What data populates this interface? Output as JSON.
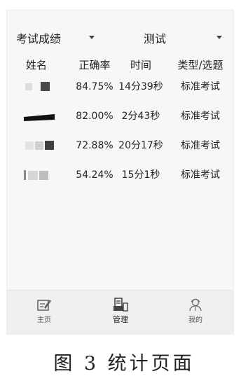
{
  "filters": {
    "left_select": "考试成绩",
    "right_select": "测试"
  },
  "table": {
    "headers": {
      "name": "姓名",
      "accuracy": "正确率",
      "time": "时间",
      "type": "类型/选题"
    },
    "rows": [
      {
        "accuracy": "84.75%",
        "time": "14分39秒",
        "type": "标准考试"
      },
      {
        "accuracy": "82.00%",
        "time": "2分43秒",
        "type": "标准考试"
      },
      {
        "accuracy": "72.88%",
        "time": "20分17秒",
        "type": "标准考试"
      },
      {
        "accuracy": "54.24%",
        "time": "15分1秒",
        "type": "标准考试"
      }
    ]
  },
  "tabbar": {
    "items": [
      {
        "label": "主页",
        "icon": "edit-icon"
      },
      {
        "label": "管理",
        "icon": "manage-icon"
      },
      {
        "label": "我的",
        "icon": "user-icon"
      }
    ],
    "active_index": 1
  },
  "caption": "图 3 统计页面"
}
